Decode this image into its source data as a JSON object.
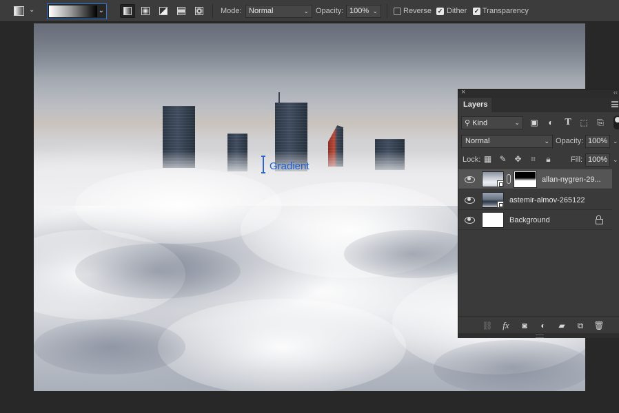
{
  "options_bar": {
    "tool_icon": "gradient-tool-icon",
    "gradient_types": [
      "linear",
      "radial",
      "angle",
      "reflected",
      "diamond"
    ],
    "mode_label": "Mode:",
    "mode_value": "Normal",
    "opacity_label": "Opacity:",
    "opacity_value": "100%",
    "reverse_label": "Reverse",
    "reverse_checked": false,
    "dither_label": "Dither",
    "dither_checked": true,
    "transparency_label": "Transparency",
    "transparency_checked": true,
    "check_mark": "✓"
  },
  "canvas": {
    "cursor_label": "Gradient",
    "accent_color": "#1f5fce"
  },
  "layers_panel": {
    "tab_label": "Layers",
    "close_glyph": "×",
    "collapse_glyph": "‹‹",
    "filter_kind": "Kind",
    "blend_mode": "Normal",
    "opacity_label": "Opacity:",
    "opacity_value": "100%",
    "lock_label": "Lock:",
    "fill_label": "Fill:",
    "fill_value": "100%",
    "layers": [
      {
        "name": "allan-nygren-29...",
        "selected": true,
        "smart_object": true,
        "has_mask": true
      },
      {
        "name": "astemir-almov-265122",
        "selected": false,
        "smart_object": true,
        "has_mask": false
      },
      {
        "name": "Background",
        "selected": false,
        "smart_object": false,
        "locked": true
      }
    ],
    "footer_icons": [
      "link-layers-icon",
      "fx-icon",
      "add-mask-icon",
      "adjustment-layer-icon",
      "new-group-icon",
      "new-layer-icon",
      "trash-icon"
    ],
    "fx_label": "fx"
  }
}
